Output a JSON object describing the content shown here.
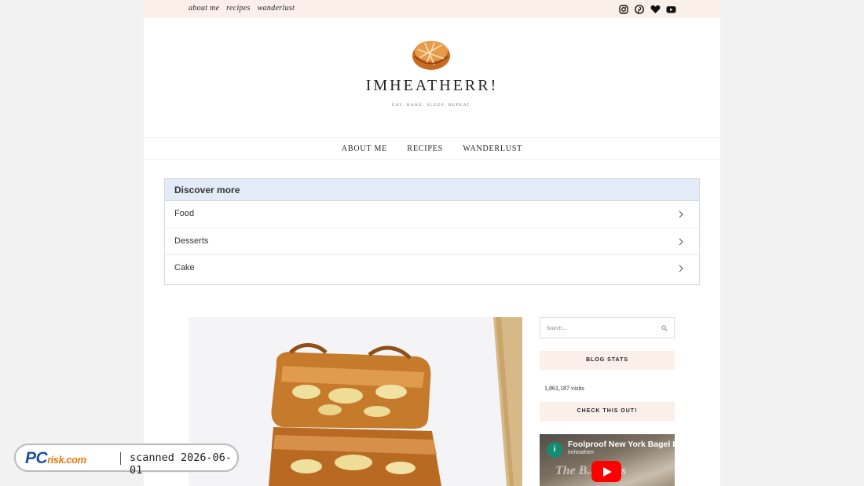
{
  "topbar": {
    "links": [
      "about me",
      "recipes",
      "wanderlust"
    ],
    "social": [
      "instagram-icon",
      "pinterest-icon",
      "heart-icon",
      "youtube-icon"
    ]
  },
  "header": {
    "title": "IMHEATHERR!",
    "tagline": "EAT. BAKE. SLEEP. REPEAT."
  },
  "nav": {
    "items": [
      "ABOUT ME",
      "RECIPES",
      "WANDERLUST"
    ]
  },
  "discover": {
    "heading": "Discover more",
    "items": [
      "Food",
      "Desserts",
      "Cake"
    ]
  },
  "sidebar": {
    "search_placeholder": "Search ...",
    "blog_stats_title": "BLOG STATS",
    "visits": "1,861,187 visits",
    "check_title": "CHECK THIS OUT!",
    "video": {
      "title": "Foolproof New York Bagel R",
      "channel": "imheatherr",
      "overlay": "The B... agels"
    }
  },
  "badge": {
    "brand": "PC",
    "brand_suffix": "risk.com",
    "scanned": "scanned 2026-06-01"
  },
  "colors": {
    "topbar_bg": "#fbefe9",
    "discover_head_bg": "#e3ebf8",
    "youtube_red": "#ff0000"
  }
}
